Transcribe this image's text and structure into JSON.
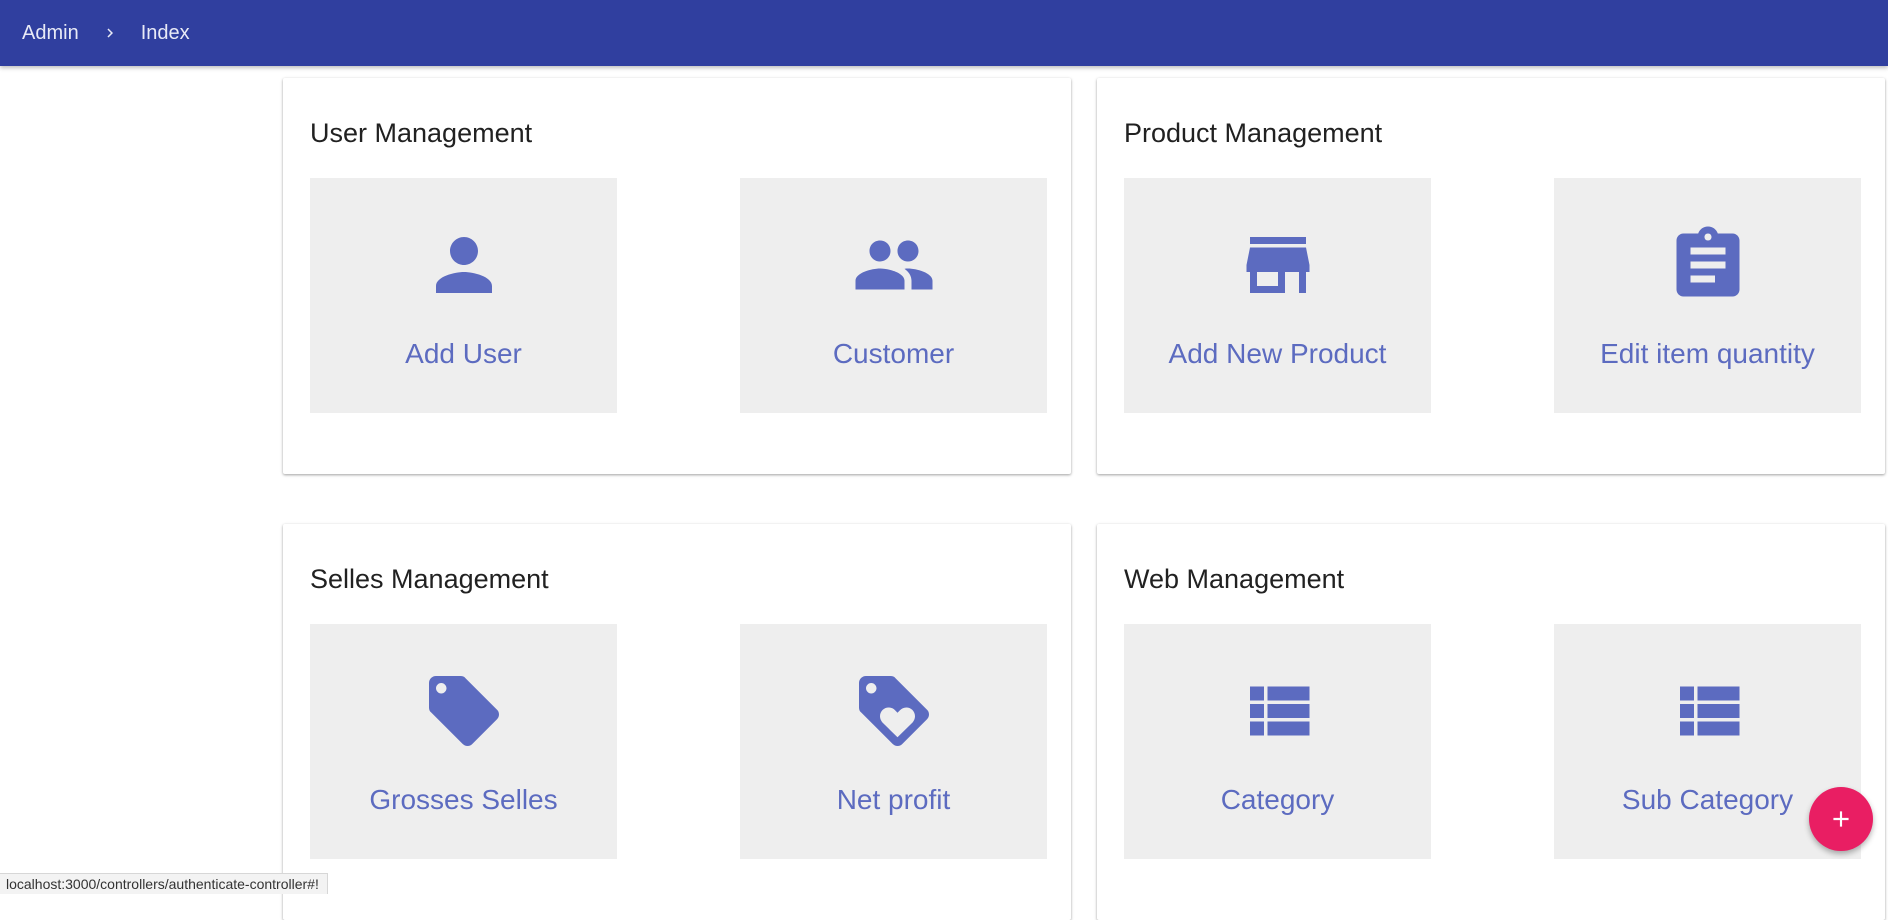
{
  "breadcrumb": {
    "items": [
      "Admin",
      "Index"
    ]
  },
  "colors": {
    "topbar": "#303f9f",
    "accent": "#5c6bc0",
    "tile_bg": "#eeeeee",
    "fab": "#e91e63"
  },
  "sections": [
    {
      "title": "User Management",
      "tiles": [
        {
          "label": "Add User",
          "icon": "person-icon"
        },
        {
          "label": "Customer",
          "icon": "people-icon"
        }
      ]
    },
    {
      "title": "Product Management",
      "tiles": [
        {
          "label": "Add New Product",
          "icon": "store-icon"
        },
        {
          "label": "Edit item quantity",
          "icon": "clipboard-icon"
        }
      ]
    },
    {
      "title": "Selles Management",
      "tiles": [
        {
          "label": "Grosses Selles",
          "icon": "tag-icon"
        },
        {
          "label": "Net profit",
          "icon": "tag-heart-icon"
        }
      ]
    },
    {
      "title": "Web Management",
      "tiles": [
        {
          "label": "Category",
          "icon": "list-icon"
        },
        {
          "label": "Sub Category",
          "icon": "list-icon"
        }
      ]
    }
  ],
  "fab": {
    "icon": "plus-icon"
  },
  "status_url": "localhost:3000/controllers/authenticate-controller#!"
}
